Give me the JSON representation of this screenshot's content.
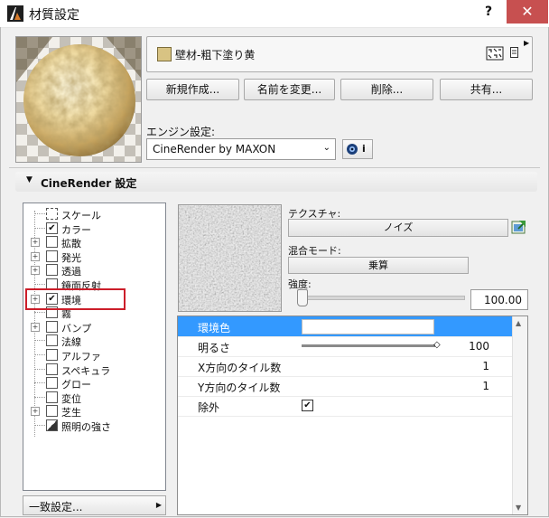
{
  "window": {
    "title": "材質設定",
    "help": "?",
    "close": "✕"
  },
  "material": {
    "name": "壁材-粗下塗り黄",
    "swatch_color": "#d8c383"
  },
  "buttons": {
    "new": "新規作成...",
    "rename": "名前を変更...",
    "delete": "削除...",
    "share": "共有..."
  },
  "engine": {
    "label": "エンジン設定:",
    "value": "CineRender by MAXON",
    "info": "i"
  },
  "section": {
    "title": "CineRender 設定"
  },
  "tree": [
    {
      "label": "スケール",
      "checked": false,
      "expandable": false,
      "special": "scale"
    },
    {
      "label": "カラー",
      "checked": true,
      "expandable": false
    },
    {
      "label": "拡散",
      "checked": false,
      "expandable": true
    },
    {
      "label": "発光",
      "checked": false,
      "expandable": true
    },
    {
      "label": "透過",
      "checked": false,
      "expandable": true
    },
    {
      "label": "鏡面反射",
      "checked": false,
      "expandable": false
    },
    {
      "label": "環境",
      "checked": true,
      "expandable": true,
      "selected": true
    },
    {
      "label": "霧",
      "checked": false,
      "expandable": false
    },
    {
      "label": "バンプ",
      "checked": false,
      "expandable": true
    },
    {
      "label": "法線",
      "checked": false,
      "expandable": false
    },
    {
      "label": "アルファ",
      "checked": false,
      "expandable": false
    },
    {
      "label": "スペキュラ",
      "checked": false,
      "expandable": false
    },
    {
      "label": "グロー",
      "checked": false,
      "expandable": false
    },
    {
      "label": "変位",
      "checked": false,
      "expandable": false
    },
    {
      "label": "芝生",
      "checked": false,
      "expandable": true
    },
    {
      "label": "照明の強さ",
      "checked": false,
      "expandable": false,
      "special": "light"
    }
  ],
  "bottom": {
    "label": "一致設定..."
  },
  "texture": {
    "label": "テクスチャ:",
    "value": "ノイズ"
  },
  "blend": {
    "label": "混合モード:",
    "value": "乗算"
  },
  "strength": {
    "label": "強度:",
    "value": "100.00",
    "level": 0
  },
  "properties": {
    "rows": [
      {
        "label": "環境色",
        "value": "",
        "type": "color",
        "color": "#ffffff"
      },
      {
        "label": "明るさ",
        "value": "100",
        "type": "slider",
        "level": 1.0
      },
      {
        "label": "X方向のタイル数",
        "value": "1",
        "type": "number"
      },
      {
        "label": "Y方向のタイル数",
        "value": "1",
        "type": "number"
      },
      {
        "label": "除外",
        "value": "",
        "type": "checkbox",
        "checked": true
      }
    ],
    "selected_color": "#3399ff"
  }
}
